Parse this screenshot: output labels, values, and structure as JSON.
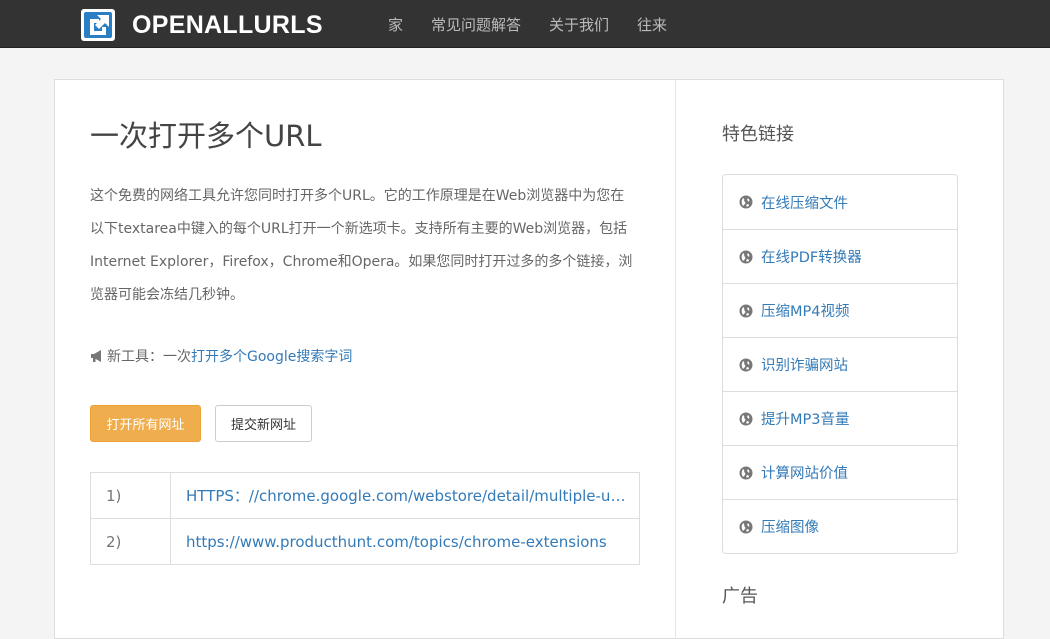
{
  "brand": {
    "name": "OPENALLURLS"
  },
  "nav": [
    {
      "label": "家"
    },
    {
      "label": "常见问题解答"
    },
    {
      "label": "关于我们"
    },
    {
      "label": "往来"
    }
  ],
  "main": {
    "title": "一次打开多个URL",
    "intro": "这个免费的网络工具允许您同时打开多个URL。它的工作原理是在Web浏览器中为您在以下textarea中键入的每个URL打开一个新选项卡。支持所有主要的Web浏览器，包括Internet Explorer，Firefox，Chrome和Opera。如果您同时打开过多的多个链接，浏览器可能会冻结几秒钟。",
    "new_tool_prefix": "新工具：一次",
    "new_tool_link": "打开多个Google搜索字词",
    "open_all_label": "打开所有网址",
    "submit_label": "提交新网址",
    "urls": [
      {
        "num": "1)",
        "url": "HTTPS：//chrome.google.com/webstore/detail/multiple-url -..."
      },
      {
        "num": "2)",
        "url": "https://www.producthunt.com/topics/chrome-extensions"
      }
    ]
  },
  "sidebar": {
    "title": "特色链接",
    "items": [
      {
        "label": "在线压缩文件",
        "icon": "globe-icon"
      },
      {
        "label": "在线PDF转换器",
        "icon": "globe-icon"
      },
      {
        "label": "压缩MP4视频",
        "icon": "globe-icon"
      },
      {
        "label": "识别诈骗网站",
        "icon": "globe-icon"
      },
      {
        "label": "提升MP3音量",
        "icon": "globe-icon"
      },
      {
        "label": "计算网站价值",
        "icon": "globe-icon"
      },
      {
        "label": "压缩图像",
        "icon": "globe-icon"
      }
    ],
    "ad_title": "广告"
  },
  "colors": {
    "navbar": "#333333",
    "link": "#337ab7",
    "warning_button": "#f0ad4e",
    "logo_blue": "#2a7fc4"
  }
}
